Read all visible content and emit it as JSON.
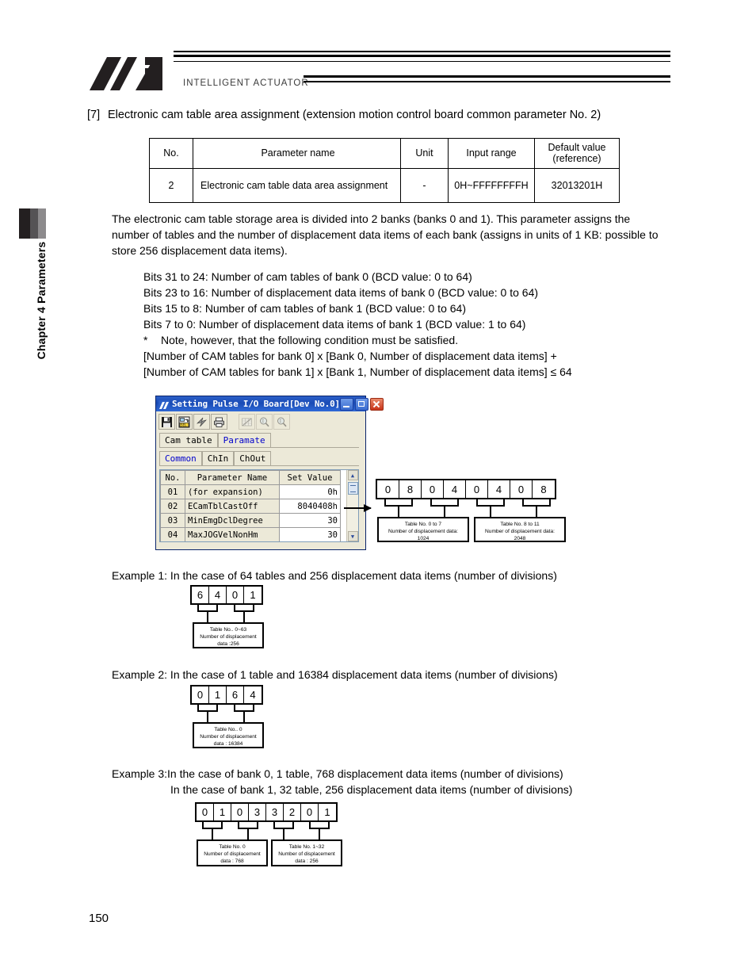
{
  "header": {
    "logo_alt": "IA logo",
    "caption": "INTELLIGENT ACTUATOR"
  },
  "chapter_tab": {
    "label": "Chapter 4 Parameters"
  },
  "section": {
    "number": "[7]",
    "title": "Electronic cam table area assignment (extension motion control board common parameter No. 2)"
  },
  "param_table": {
    "headers": [
      "No.",
      "Parameter name",
      "Unit",
      "Input range",
      "Default value\n(reference)"
    ],
    "header_default_line1": "Default value",
    "header_default_line2": "(reference)",
    "rows": [
      {
        "no": "2",
        "name": "Electronic cam table data area assignment",
        "unit": "-",
        "range": "0H~FFFFFFFFH",
        "default": "32013201H"
      }
    ]
  },
  "intro_paragraph": "The electronic cam table storage area is divided into 2 banks (banks 0 and 1). This parameter assigns the number of tables and the number of displacement data items of each bank (assigns in units of 1 KB: possible to store 256 displacement data items).",
  "bits_block": {
    "lines": [
      "Bits 31 to 24: Number of cam tables of bank 0 (BCD value: 0 to 64)",
      "Bits 23 to 16: Number of displacement data items of bank 0 (BCD value: 0 to 64)",
      "Bits 15 to 8: Number of cam tables of bank 1 (BCD value: 0 to 64)",
      "Bits 7 to 0: Number of displacement data items of bank 1 (BCD value: 1 to 64)"
    ],
    "note_star": "*",
    "note_text": "Note, however, that the following condition must be satisfied.",
    "condition_line1": "[Number of CAM tables for bank 0] x [Bank 0, Number of displacement data items] +",
    "condition_line2": "[Number of CAM tables for bank 1] x [Bank 1, Number of displacement data items] ≤ 64"
  },
  "dialog": {
    "title": "Setting Pulse I/O Board[Dev No.0]",
    "title_icon": "app-icon",
    "window_buttons": [
      {
        "name": "minimize-button",
        "glyph": "_"
      },
      {
        "name": "maximize-button",
        "glyph": "□"
      },
      {
        "name": "close-button",
        "glyph": "×"
      }
    ],
    "toolbar": [
      {
        "name": "save-icon",
        "enabled": true
      },
      {
        "name": "transfer-to-sel-icon",
        "enabled": true
      },
      {
        "name": "lightning-icon",
        "enabled": true
      },
      {
        "name": "print-icon",
        "enabled": true
      },
      {
        "name": "edit-table-icon",
        "enabled": false
      },
      {
        "name": "zoom-in-icon",
        "enabled": false
      },
      {
        "name": "zoom-out-icon",
        "enabled": false
      }
    ],
    "main_tabs": [
      {
        "label": "Cam table",
        "selected": false
      },
      {
        "label": "Paramate",
        "selected": true
      }
    ],
    "sub_tabs": [
      {
        "label": "Common",
        "selected": true
      },
      {
        "label": "ChIn",
        "selected": false
      },
      {
        "label": "ChOut",
        "selected": false
      }
    ],
    "grid": {
      "headers": [
        "No.",
        "Parameter Name",
        "Set Value"
      ],
      "rows": [
        {
          "no": "01",
          "name": "(for expansion)",
          "value": "0h"
        },
        {
          "no": "02",
          "name": "ECamTblCastOff",
          "value": "8040408h"
        },
        {
          "no": "03",
          "name": "MinEmgDclDegree",
          "value": "30"
        },
        {
          "no": "04",
          "name": "MaxJOGVelNonHm",
          "value": "30"
        }
      ]
    },
    "scrollbar": {
      "up_glyph": "▲",
      "down_glyph": "▼"
    }
  },
  "main_diagram": {
    "digits": [
      "0",
      "8",
      "0",
      "4",
      "0",
      "4",
      "0",
      "8"
    ],
    "notes": [
      {
        "line1": "Table No. 0 to 7",
        "line2": "Number of displacement data:",
        "line3": "1024"
      },
      {
        "line1": "Table No. 8 to 11",
        "line2": "Number of displacement data:",
        "line3": "2048"
      }
    ]
  },
  "examples": [
    {
      "heading": "Example 1: In the case of 64 tables and 256 displacement data items (number of divisions)",
      "heading_cont": "",
      "digits": [
        "6",
        "4",
        "0",
        "1"
      ],
      "notes": [
        {
          "line1": "Table No..  0~63",
          "line2": "Number of displacement",
          "line3": "data :256"
        }
      ]
    },
    {
      "heading": "Example 2: In the case of 1 table and 16384 displacement data items (number of divisions)",
      "heading_cont": "",
      "digits": [
        "0",
        "1",
        "6",
        "4"
      ],
      "notes": [
        {
          "line1": "Table No..  0",
          "line2": "Number of displacement",
          "line3": "data : 16384"
        }
      ]
    },
    {
      "heading": "Example 3:In the case of bank 0, 1 table, 768 displacement data items (number of divisions)",
      "heading_cont": "In the case of bank 1, 32 table, 256 displacement data items (number of divisions)",
      "digits": [
        "0",
        "1",
        "0",
        "3",
        "3",
        "2",
        "0",
        "1"
      ],
      "notes": [
        {
          "line1": "Table No.  0",
          "line2": "Number of displacement",
          "line3": "data : 768"
        },
        {
          "line1": "Table No.  1~32",
          "line2": "Number of displacement",
          "line3": "data : 256"
        }
      ]
    }
  ],
  "page_number": "150"
}
